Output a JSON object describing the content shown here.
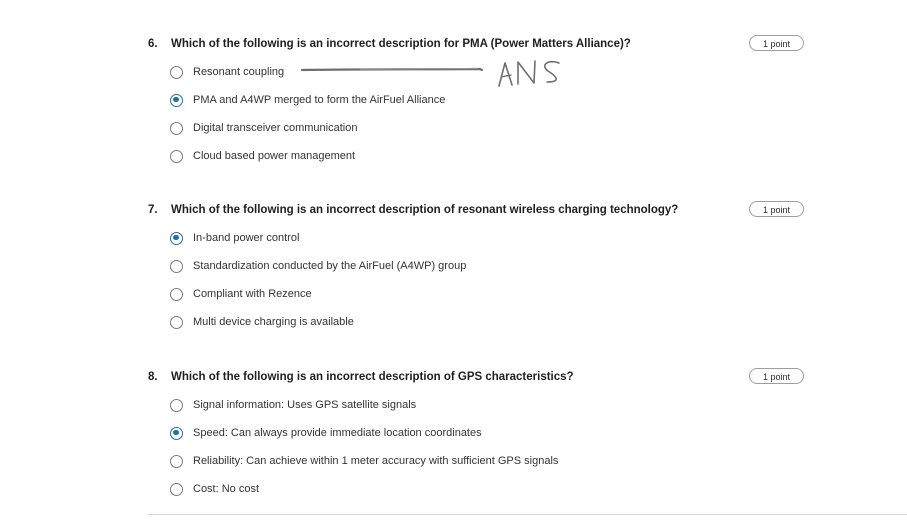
{
  "questions": [
    {
      "number": "6.",
      "text": "Which of the following is an incorrect description for PMA (Power Matters Alliance)?",
      "points": "1 point",
      "options": [
        {
          "label": "Resonant coupling",
          "selected": false
        },
        {
          "label": "PMA and A4WP merged to form the AirFuel Alliance",
          "selected": true
        },
        {
          "label": "Digital transceiver communication",
          "selected": false
        },
        {
          "label": "Cloud based power management",
          "selected": false
        }
      ]
    },
    {
      "number": "7.",
      "text": "Which of the following is an incorrect description of resonant wireless charging technology?",
      "points": "1 point",
      "options": [
        {
          "label": "In-band power control",
          "selected": true
        },
        {
          "label": "Standardization conducted by the AirFuel (A4WP) group",
          "selected": false
        },
        {
          "label": "Compliant with Rezence",
          "selected": false
        },
        {
          "label": "Multi device charging is available",
          "selected": false
        }
      ]
    },
    {
      "number": "8.",
      "text": "Which of the following is an incorrect description of GPS characteristics?",
      "points": "1 point",
      "options": [
        {
          "label": "Signal information: Uses GPS satellite signals",
          "selected": false
        },
        {
          "label": "Speed: Can always provide immediate location coordinates",
          "selected": true
        },
        {
          "label": "Reliability: Can achieve within 1 meter accuracy with sufficient GPS signals",
          "selected": false
        },
        {
          "label": "Cost: No cost",
          "selected": false
        }
      ]
    }
  ],
  "annotation": {
    "text": "ANS"
  },
  "colors": {
    "selected": "#1f6fb5",
    "unselected_border": "#7a7a7a"
  }
}
